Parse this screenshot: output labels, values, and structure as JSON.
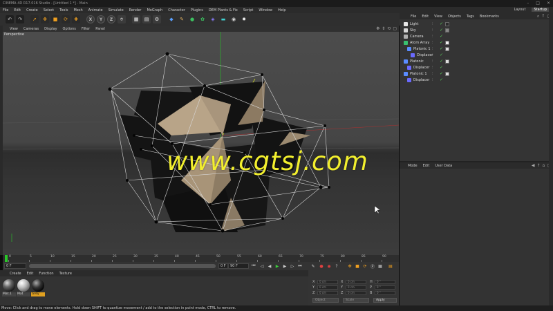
{
  "window": {
    "title": "CINEMA 4D R17.016 Studio - [Untitled 1 *] - Main",
    "controls": [
      "–",
      "□",
      "✕"
    ]
  },
  "menubar": {
    "items": [
      "File",
      "Edit",
      "Create",
      "Select",
      "Tools",
      "Mesh",
      "Animate",
      "Simulate",
      "Render",
      "MoGraph",
      "Character",
      "Plugins",
      "DEM Plants & Fix",
      "Script",
      "Window",
      "Help"
    ],
    "layout_label": "Layout",
    "layout_value": "Startup"
  },
  "viewport": {
    "menu": [
      "View",
      "Cameras",
      "Display",
      "Options",
      "Filter",
      "Panel"
    ],
    "camera_label": "Perspective",
    "watermark": "www.cgtsj.com"
  },
  "timeline": {
    "ticks": [
      "0",
      "5",
      "10",
      "15",
      "20",
      "25",
      "30",
      "35",
      "40",
      "45",
      "50",
      "55",
      "60",
      "65",
      "70",
      "75",
      "80",
      "85",
      "90"
    ],
    "current_frame": "0 F",
    "start_field": "0 F",
    "end_field": "90 F",
    "end_field2": "90 F",
    "frame_indicator": "0 F"
  },
  "material_manager": {
    "menu": [
      "Create",
      "Edit",
      "Function",
      "Texture"
    ],
    "materials": [
      {
        "name": "Mat.1",
        "selected": false
      },
      {
        "name": "Mat",
        "selected": false
      },
      {
        "name": "Grey",
        "selected": true
      }
    ]
  },
  "coordinates": {
    "rows": [
      {
        "a": "X",
        "av": "0 cm",
        "b": "X",
        "bv": "0 cm",
        "c": "H",
        "cv": "0 °"
      },
      {
        "a": "Y",
        "av": "0 cm",
        "b": "Y",
        "bv": "0 cm",
        "c": "P",
        "cv": "0 °"
      },
      {
        "a": "Z",
        "av": "0 cm",
        "b": "Z",
        "bv": "0 cm",
        "c": "B",
        "cv": "0 °"
      }
    ],
    "mode_select": "Object",
    "scale_select": "Scale",
    "apply_label": "Apply"
  },
  "status_bar": "Move: Click and drag to move elements. Hold down SHIFT to quantize movement / add to the selection in point mode, CTRL to remove.",
  "object_manager": {
    "menu": [
      "File",
      "Edit",
      "View",
      "Objects",
      "Tags",
      "Bookmarks"
    ],
    "objects": [
      {
        "name": "Light",
        "indent": 0,
        "icon": "#e8e8e8",
        "tag": "#2a2a2a"
      },
      {
        "name": "Sky",
        "indent": 0,
        "icon": "#d8d8d8",
        "tag": "#888"
      },
      {
        "name": "Camera",
        "indent": 0,
        "icon": "#b0b0b0",
        "tag": ""
      },
      {
        "name": "Atom Array",
        "indent": 0,
        "icon": "#39c070",
        "tag": "#eeeeee"
      },
      {
        "name": "Platonic 1",
        "indent": 1,
        "icon": "#5a8cff",
        "tag": "#ddd"
      },
      {
        "name": "Displacer",
        "indent": 2,
        "icon": "#6a6aff",
        "tag": ""
      },
      {
        "name": "Platonic",
        "indent": 0,
        "icon": "#5a8cff",
        "tag": "#ddd"
      },
      {
        "name": "Displacer",
        "indent": 1,
        "icon": "#6a6aff",
        "tag": ""
      },
      {
        "name": "Platonic 1",
        "indent": 0,
        "icon": "#5a8cff",
        "tag": "#ddd"
      },
      {
        "name": "Displacer",
        "indent": 1,
        "icon": "#6a6aff",
        "tag": ""
      }
    ]
  },
  "attribute_manager": {
    "menu": [
      "Mode",
      "Edit",
      "User Data"
    ]
  },
  "colors": {
    "accent": "#f0a020",
    "watermark": "#f2ef2e",
    "timeline_cursor": "#28c828"
  }
}
